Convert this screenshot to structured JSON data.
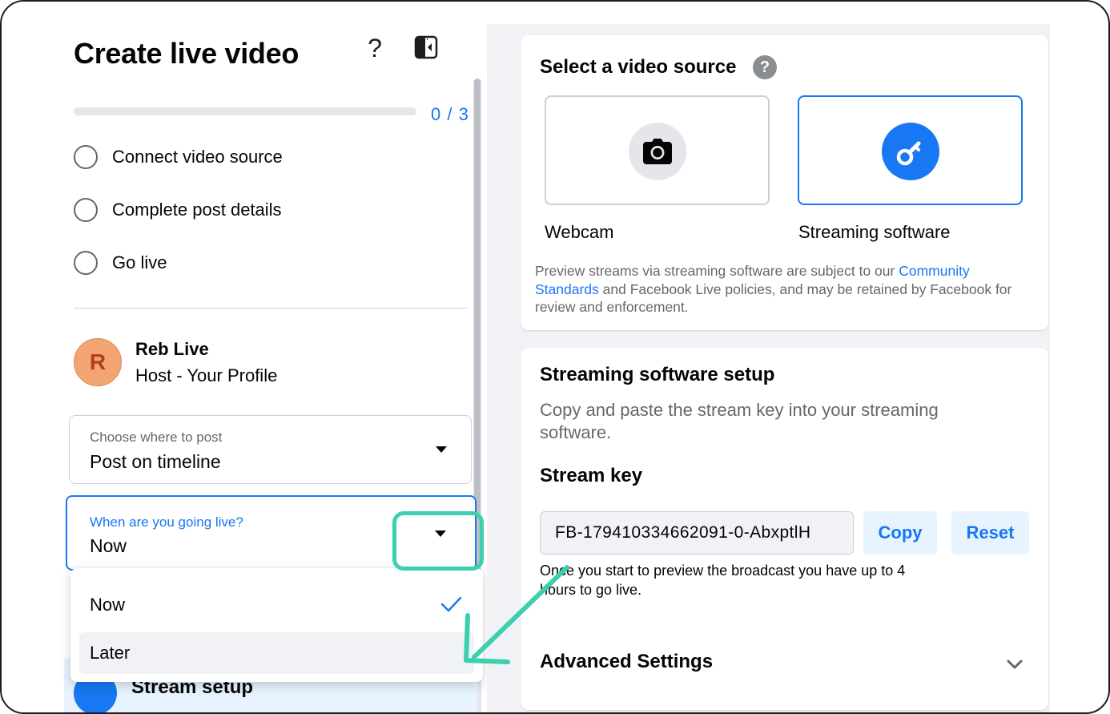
{
  "left_panel": {
    "title": "Create live video",
    "progress": {
      "completed": 0,
      "total": 3,
      "text": "0 / 3"
    },
    "steps": [
      {
        "label": "Connect video source"
      },
      {
        "label": "Complete post details"
      },
      {
        "label": "Go live"
      }
    ],
    "profile": {
      "initial": "R",
      "name": "Reb Live",
      "role": "Host - Your Profile"
    },
    "post_select": {
      "label": "Choose where to post",
      "value": "Post on timeline"
    },
    "when_select": {
      "label": "When are you going live?",
      "value": "Now"
    },
    "when_menu": {
      "options": [
        "Now",
        "Later"
      ],
      "selected": "Now",
      "hovered": "Later"
    },
    "nav_item": {
      "label": "Stream setup"
    }
  },
  "video_source": {
    "title": "Select a video source",
    "help_icon": "?",
    "options": [
      {
        "label": "Webcam",
        "icon": "camera-icon",
        "selected": false
      },
      {
        "label": "Streaming software",
        "icon": "key-icon",
        "selected": true
      }
    ],
    "policy": {
      "text1": "Preview streams via streaming software are subject to our ",
      "link": "Community Standards",
      "text2": " and Facebook Live policies, and may be retained by Facebook for review and enforcement."
    }
  },
  "streaming_setup": {
    "title": "Streaming software setup",
    "description": "Copy and paste the stream key into your streaming software.",
    "stream_key_label": "Stream key",
    "stream_key_value": "FB-179410334662091-0-AbxptlH",
    "copy_label": "Copy",
    "reset_label": "Reset",
    "note": "Once you start to preview the broadcast you have up to 4 hours to go live.",
    "advanced_label": "Advanced Settings"
  },
  "colors": {
    "accent": "#1877f2",
    "annotation": "#3ccfb0",
    "soft_button": "#e7f3ff",
    "panel_bg": "#f0f2f5"
  }
}
